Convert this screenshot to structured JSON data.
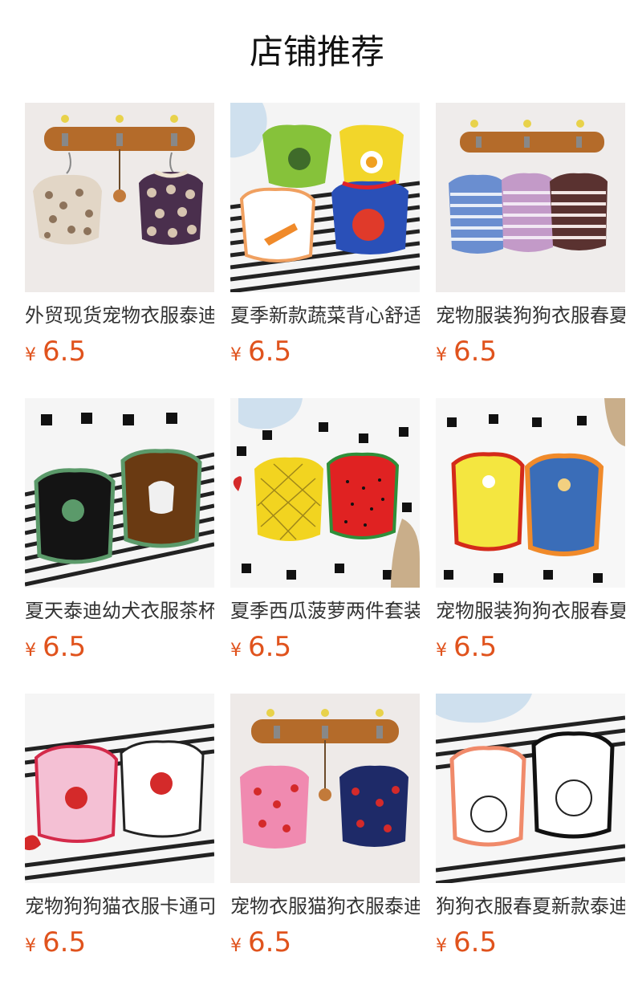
{
  "title": "店铺推荐",
  "products": [
    {
      "name": "外贸现货宠物衣服泰迪",
      "currency": "¥",
      "price": "6.5",
      "image": "hanger-skull-vests"
    },
    {
      "name": "夏季新款蔬菜背心舒适",
      "currency": "¥",
      "price": "6.5",
      "image": "vegetable-vests"
    },
    {
      "name": "宠物服装狗狗衣服春夏",
      "currency": "¥",
      "price": "6.5",
      "image": "hanger-striped-vests"
    },
    {
      "name": "夏天泰迪幼犬衣服茶杯",
      "currency": "¥",
      "price": "6.5",
      "image": "frog-bear-vests"
    },
    {
      "name": "夏季西瓜菠萝两件套装",
      "currency": "¥",
      "price": "6.5",
      "image": "watermelon-pineapple-vests"
    },
    {
      "name": "宠物服装狗狗衣服春夏",
      "currency": "¥",
      "price": "6.5",
      "image": "paw-vests"
    },
    {
      "name": "宠物狗狗猫衣服卡通可",
      "currency": "¥",
      "price": "6.5",
      "image": "cherry-vests"
    },
    {
      "name": "宠物衣服猫狗衣服泰迪",
      "currency": "¥",
      "price": "6.5",
      "image": "hanger-lobster-vests"
    },
    {
      "name": "狗狗衣服春夏新款泰迪",
      "currency": "¥",
      "price": "6.5",
      "image": "bear-vests"
    }
  ]
}
